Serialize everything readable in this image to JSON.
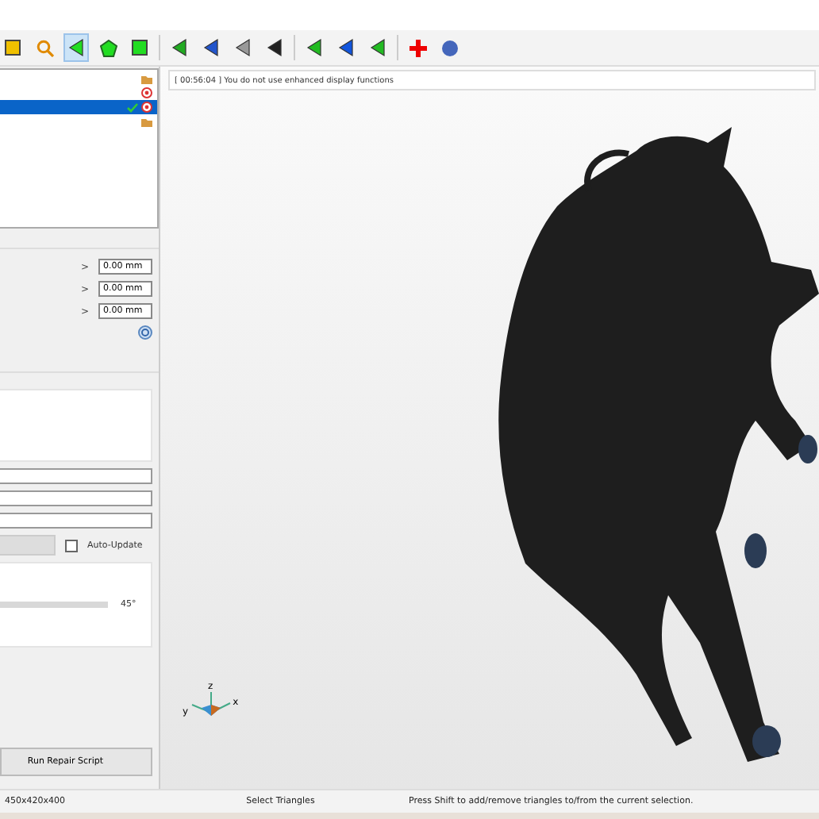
{
  "tree": {
    "items": [
      {
        "kind": "folder",
        "selected": false,
        "checked": false
      },
      {
        "kind": "target",
        "selected": false,
        "checked": false
      },
      {
        "kind": "target",
        "selected": true,
        "checked": true
      },
      {
        "kind": "folder",
        "selected": false,
        "checked": false
      }
    ]
  },
  "log": {
    "message": "[ 00:56:04 ] You do not use enhanced display functions"
  },
  "offsets": [
    {
      "arrow": ">",
      "value": "0.00 mm"
    },
    {
      "arrow": ">",
      "value": "0.00 mm"
    },
    {
      "arrow": ">",
      "value": "0.00 mm"
    }
  ],
  "options": {
    "auto_update": {
      "label": "Auto-Update",
      "checked": false
    },
    "angle": {
      "level": 1,
      "reading": "45°"
    }
  },
  "run_button": "Run Repair Script",
  "status_bar": {
    "dimensions": "450x420x400",
    "mode": "Select Triangles",
    "hint": "Press Shift to add/remove triangles to/from the current selection."
  },
  "axes": {
    "z": "z",
    "y": "y",
    "x": "x"
  }
}
